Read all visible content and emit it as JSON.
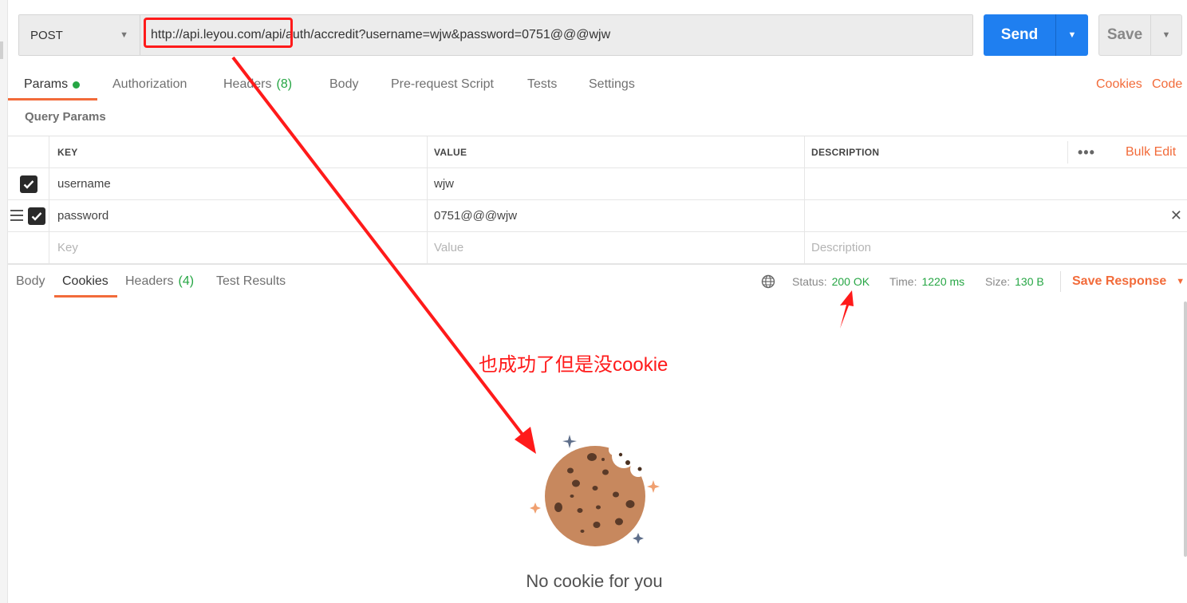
{
  "request": {
    "method": "POST",
    "url": "http://api.leyou.com/api/auth/accredit?username=wjw&password=0751@@@wjw",
    "send_label": "Send",
    "save_label": "Save"
  },
  "request_tabs": {
    "params": "Params",
    "authorization": "Authorization",
    "headers": "Headers",
    "headers_count": "(8)",
    "body": "Body",
    "prerequest": "Pre-request Script",
    "tests": "Tests",
    "settings": "Settings",
    "cookies_link": "Cookies",
    "code_link": "Code"
  },
  "query_params": {
    "title": "Query Params",
    "columns": {
      "key": "KEY",
      "value": "VALUE",
      "description": "DESCRIPTION"
    },
    "bulk_edit": "Bulk Edit",
    "rows": [
      {
        "key": "username",
        "value": "wjw",
        "description": ""
      },
      {
        "key": "password",
        "value": "0751@@@wjw",
        "description": ""
      }
    ],
    "placeholders": {
      "key": "Key",
      "value": "Value",
      "description": "Description"
    }
  },
  "response": {
    "tabs": {
      "body": "Body",
      "cookies": "Cookies",
      "headers": "Headers",
      "headers_count": "(4)",
      "test_results": "Test Results"
    },
    "status_label": "Status:",
    "status_value": "200 OK",
    "time_label": "Time:",
    "time_value": "1220 ms",
    "size_label": "Size:",
    "size_value": "130 B",
    "save_response": "Save Response",
    "empty_message": "No cookie for you"
  },
  "annotation": {
    "text": "也成功了但是没cookie",
    "color": "#ff1a1a"
  },
  "colors": {
    "accent": "#f26b3a",
    "send": "#1f7ff0",
    "success": "#26a644"
  }
}
